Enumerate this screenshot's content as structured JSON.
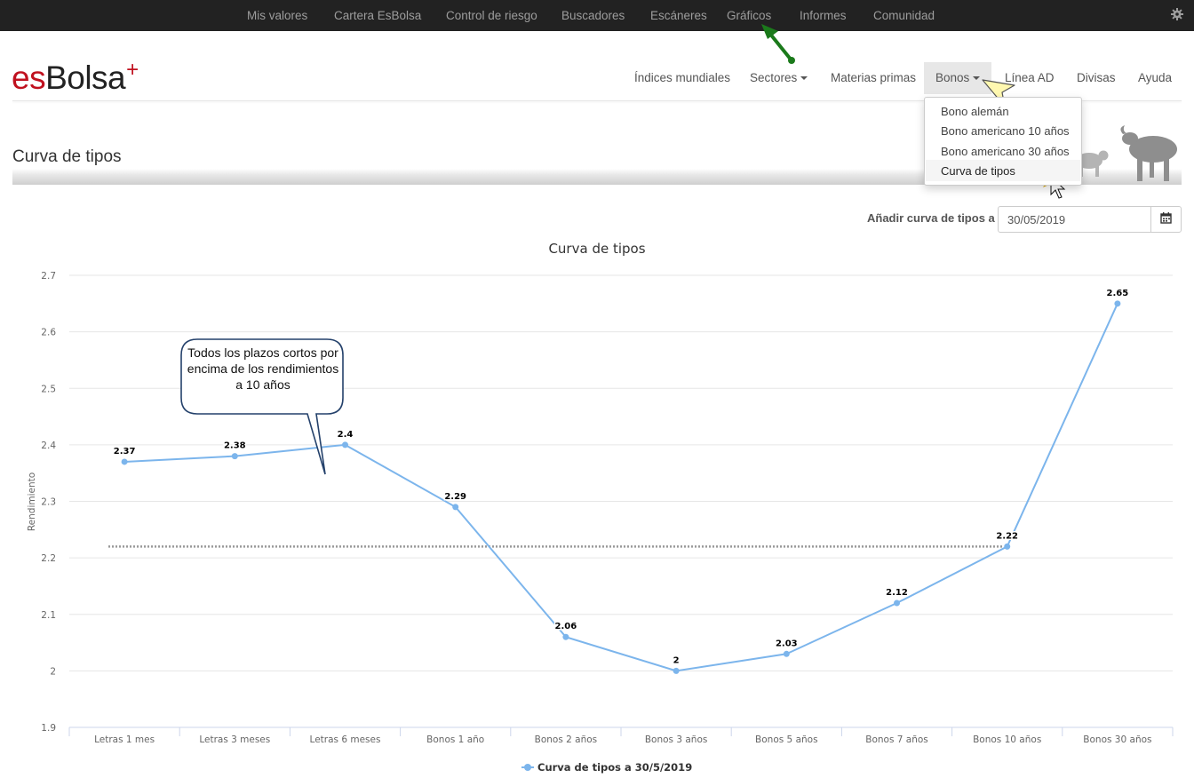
{
  "topnav": {
    "items": [
      "Mis valores",
      "Cartera EsBolsa",
      "Control de riesgo",
      "Buscadores",
      "Escáneres",
      "Gráficos",
      "Informes",
      "Comunidad"
    ]
  },
  "logo": {
    "es": "es",
    "bolsa": "Bolsa",
    "plus": "+"
  },
  "mainnav": {
    "items": [
      "Índices mundiales",
      "Sectores",
      "Materias primas",
      "Bonos",
      "Línea AD",
      "Divisas",
      "Ayuda"
    ]
  },
  "dropdown": {
    "items": [
      "Bono alemán",
      "Bono americano 10 años",
      "Bono americano 30 años",
      "Curva de tipos"
    ]
  },
  "page": {
    "title": "Curva de tipos"
  },
  "date_picker": {
    "label": "Añadir curva de tipos a",
    "value": "30/05/2019"
  },
  "callout": {
    "text": "Todos los plazos cortos por encima de los rendimientos a 10 años"
  },
  "colors": {
    "series": "#7cb5ec",
    "topbar": "#222222",
    "logo_red": "#c0111f",
    "arrow": "#1b7a1b"
  },
  "icons": {
    "settings": "gear-icon",
    "calendar": "calendar-icon"
  },
  "chart_data": {
    "type": "line",
    "title": "Curva de tipos",
    "ylabel": "Rendimiento",
    "xlabel": "",
    "categories": [
      "Letras 1 mes",
      "Letras 3 meses",
      "Letras 6 meses",
      "Bonos 1 año",
      "Bonos 2 años",
      "Bonos 3 años",
      "Bonos 5 años",
      "Bonos 7 años",
      "Bonos 10 años",
      "Bonos 30 años"
    ],
    "series": [
      {
        "name": "Curva de tipos a 30/5/2019",
        "values": [
          2.37,
          2.38,
          2.4,
          2.29,
          2.06,
          2,
          2.03,
          2.12,
          2.22,
          2.65
        ]
      }
    ],
    "yticks": [
      1.9,
      2,
      2.1,
      2.2,
      2.3,
      2.4,
      2.5,
      2.6,
      2.7
    ],
    "ylim": [
      1.9,
      2.7
    ],
    "reference_line": 2.22,
    "grid": true,
    "legend": "bottom-center"
  }
}
